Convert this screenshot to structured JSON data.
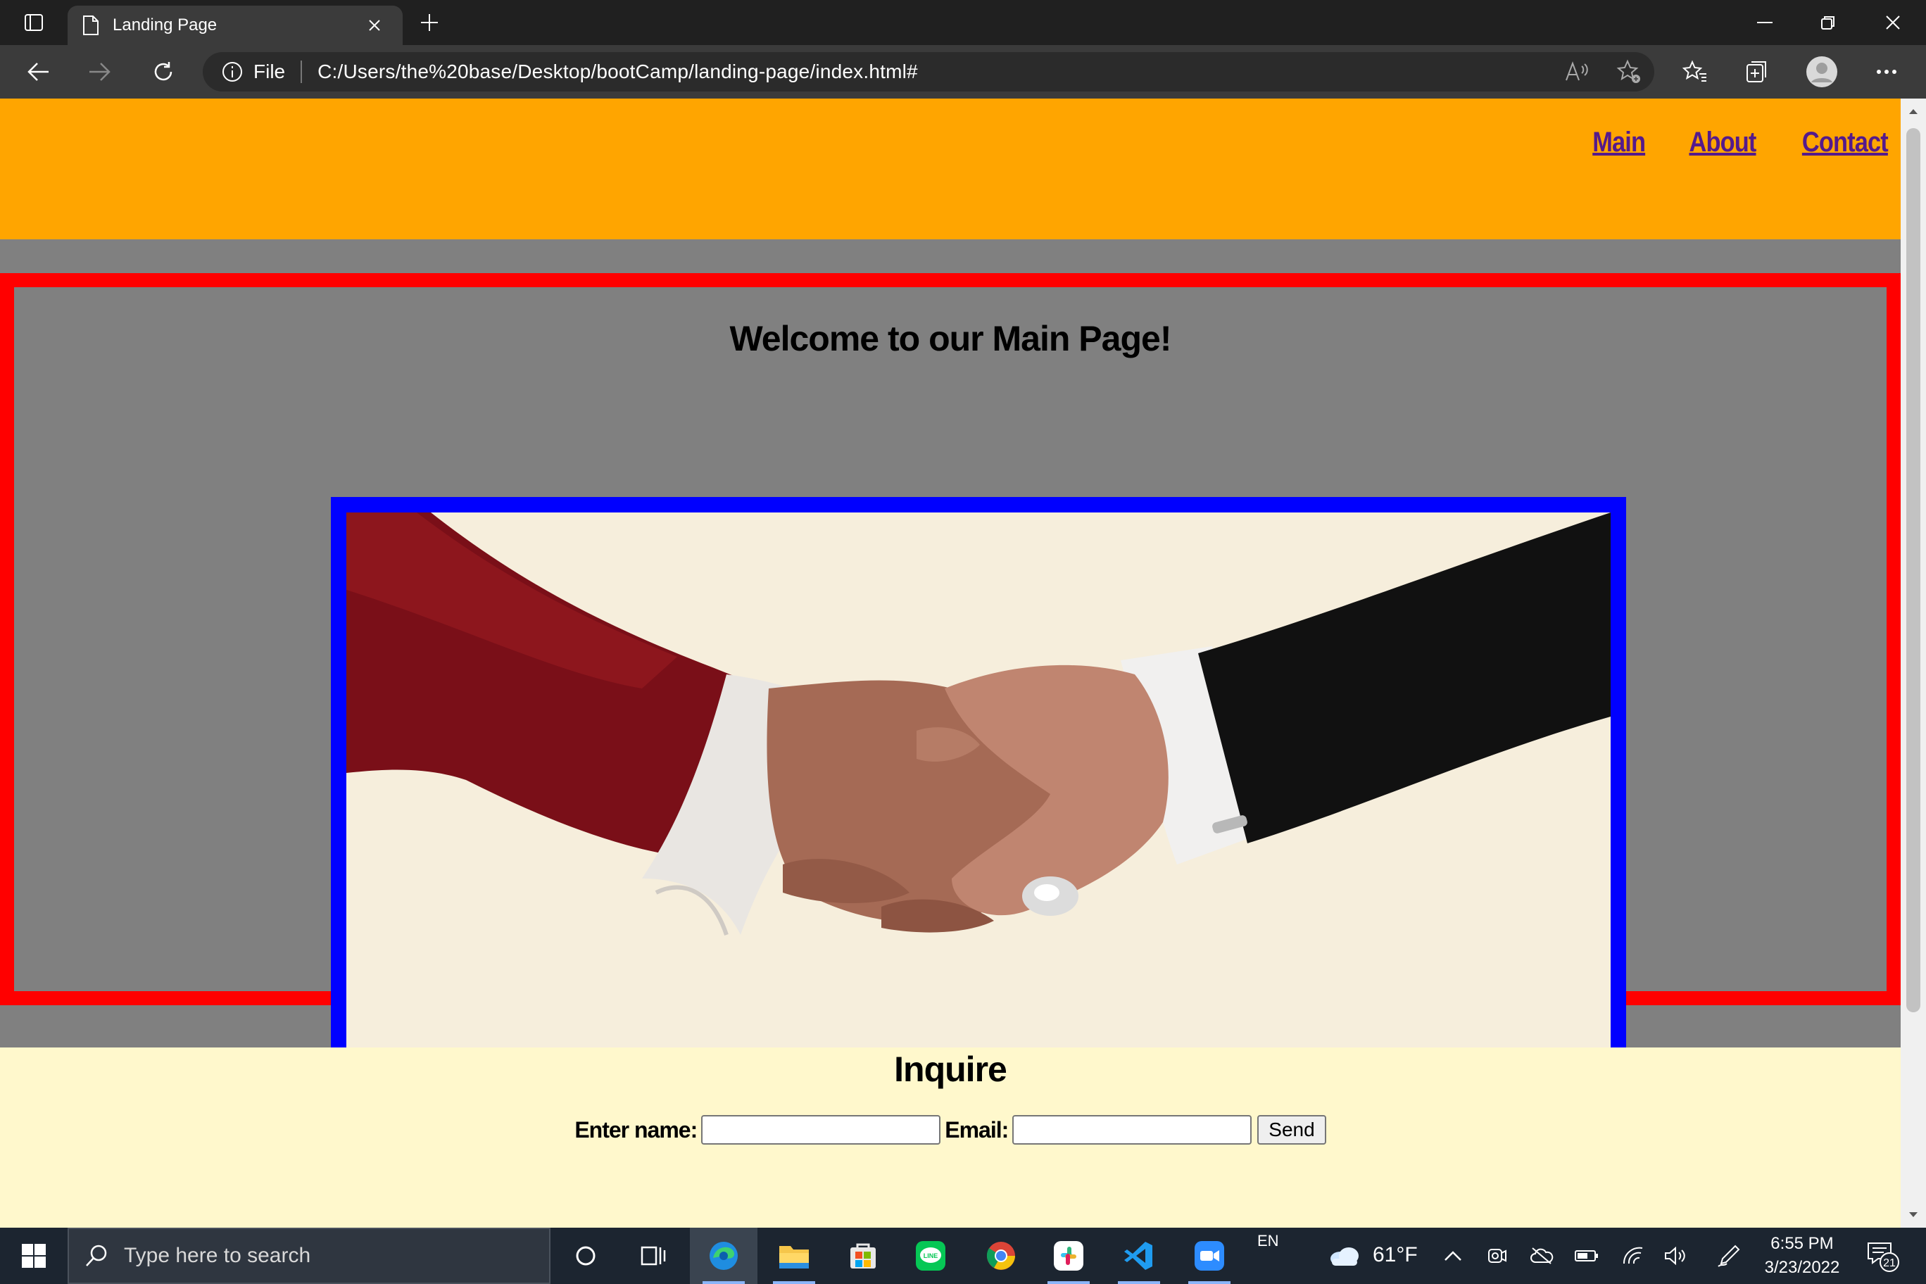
{
  "browser": {
    "tab_title": "Landing Page",
    "address_prefix": "File",
    "url": "C:/Users/the%20base/Desktop/bootCamp/landing-page/index.html#"
  },
  "page": {
    "nav": [
      "Main",
      "About",
      "Contact"
    ],
    "main_title": "Welcome to our Main Page!",
    "hero_image_alt": "handshake",
    "inquire_title": "Inquire",
    "name_label": "Enter name:",
    "email_label": "Email:",
    "send_label": "Send",
    "colors": {
      "header": "#ffa500",
      "main_border": "#ff0000",
      "image_border": "#0000ff",
      "page_bg": "#808080",
      "inquire_bg": "#fff8cc",
      "link": "#551a8b"
    }
  },
  "taskbar": {
    "search_placeholder": "Type here to search",
    "lang": "EN",
    "temperature": "61°F",
    "time": "6:55 PM",
    "date": "3/23/2022",
    "notification_count": "21",
    "apps": [
      "cortana-icon",
      "task-view-icon",
      "edge-icon",
      "file-explorer-icon",
      "store-icon",
      "line-icon",
      "chrome-icon",
      "slack-icon",
      "vscode-icon",
      "zoom-icon"
    ]
  }
}
